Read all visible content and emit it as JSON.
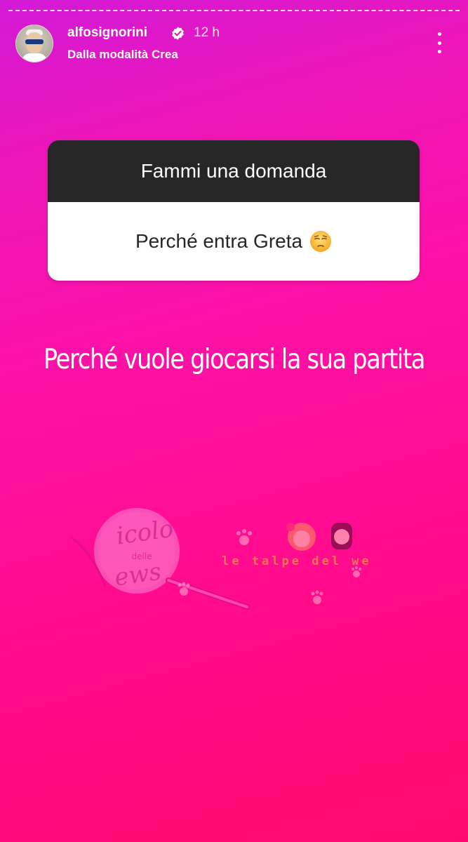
{
  "header": {
    "username": "alfosignorini",
    "time": "12 h",
    "subtitle": "Dalla modalità Crea",
    "avatar_icon": "profile-avatar",
    "verified_icon": "verified-badge-icon",
    "more_icon": "more-vertical-icon"
  },
  "question_sticker": {
    "prompt": "Fammi una domanda",
    "question": "Perché entra Greta",
    "emoji": "unamused-face-emoji"
  },
  "answer": {
    "text": "Perché  vuole giocarsi  la sua partita"
  },
  "watermark": {
    "logo_lines": [
      "icolo",
      "delle",
      "ews"
    ],
    "tagline": "le talpe del web"
  },
  "colors": {
    "gradient_top": "#d11ad6",
    "gradient_bottom": "#ff0a6c",
    "question_header_bg": "#262626",
    "question_body_bg": "#ffffff",
    "text_white": "#ffffff",
    "verified_blue": "#ffffff"
  }
}
